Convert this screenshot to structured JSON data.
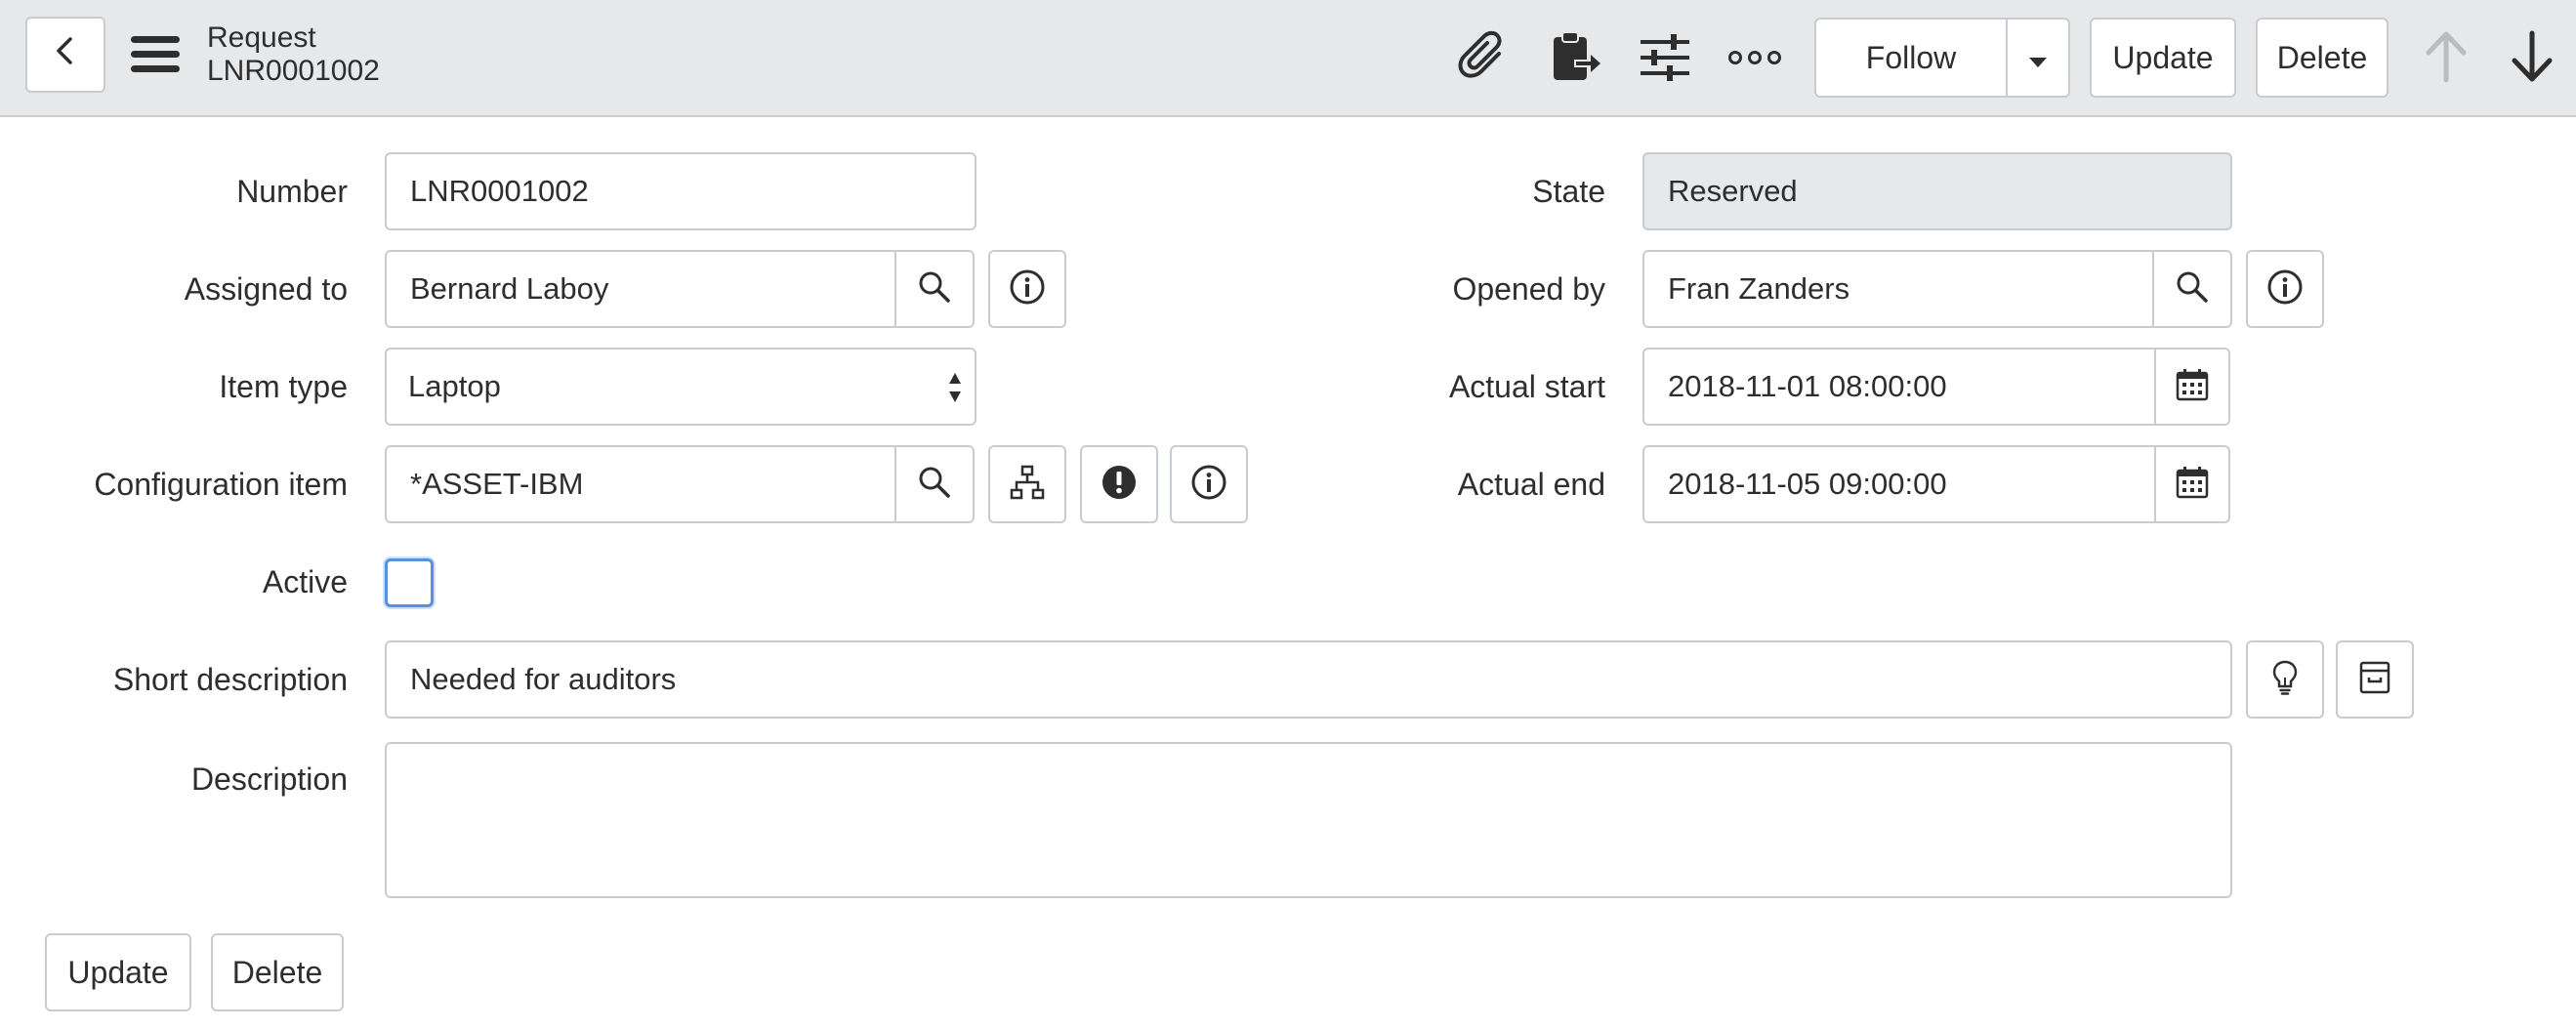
{
  "header": {
    "title": "Request",
    "record_number": "LNR0001002",
    "follow_label": "Follow",
    "update_label": "Update",
    "delete_label": "Delete",
    "icons": [
      "back-icon",
      "menu-icon",
      "paperclip-icon",
      "clipboard-icon",
      "sliders-icon",
      "more-icon",
      "caret-down-icon",
      "arrow-up-icon",
      "arrow-down-icon"
    ]
  },
  "form": {
    "number": {
      "label": "Number",
      "value": "LNR0001002"
    },
    "state": {
      "label": "State",
      "value": "Reserved"
    },
    "assigned_to": {
      "label": "Assigned to",
      "value": "Bernard Laboy"
    },
    "opened_by": {
      "label": "Opened by",
      "value": "Fran Zanders"
    },
    "item_type": {
      "label": "Item type",
      "value": "Laptop"
    },
    "actual_start": {
      "label": "Actual start",
      "value": "2018-11-01 08:00:00"
    },
    "configuration_item": {
      "label": "Configuration item",
      "value": "*ASSET-IBM"
    },
    "actual_end": {
      "label": "Actual end",
      "value": "2018-11-05 09:00:00"
    },
    "active": {
      "label": "Active",
      "checked": false
    },
    "short_description": {
      "label": "Short description",
      "value": "Needed for auditors"
    },
    "description": {
      "label": "Description",
      "value": ""
    }
  },
  "footer": {
    "update_label": "Update",
    "delete_label": "Delete"
  },
  "colors": {
    "header_bg": "#e6e8ea",
    "border": "#c8cbcf",
    "text": "#2e2e2e",
    "checkbox_focus": "#5a8fe0",
    "disabled_arrow": "#b9bcc0"
  }
}
